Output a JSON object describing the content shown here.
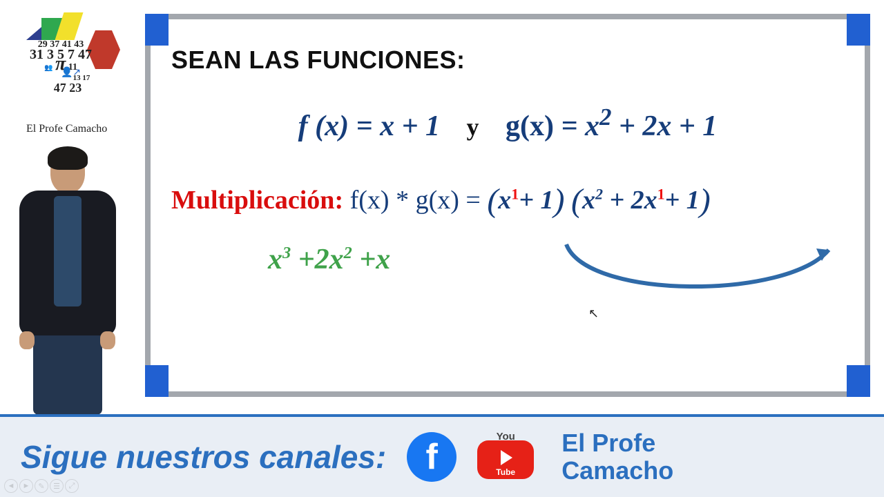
{
  "logo": {
    "numbers_row1": "29 37 41 43",
    "numbers_row2": "31 3 5 7 47",
    "numbers_row3": "11",
    "numbers_row4": "13",
    "numbers_row5": "17",
    "numbers_row6": "47 23",
    "pi": "π",
    "script": "El Profe Camacho"
  },
  "board": {
    "heading": "SEAN LAS FUNCIONES:",
    "f_lhs": "f (x)",
    "eq": " = ",
    "f_rhs": "x + 1",
    "y": "y",
    "g_lhs": "g(x)",
    "g_rhs_a": "x",
    "g_rhs_exp": "2",
    "g_rhs_b": " + 2x + 1",
    "mult_label": "Multiplicación:",
    "mult_plain": "  f(x) * g(x) =",
    "p1_a": "x",
    "p1_exp": "1",
    "p1_b": "+ 1",
    "p2_a": "x",
    "p2_exp1": "2",
    "p2_b": " + 2x",
    "p2_exp2": "1",
    "p2_c": "+ 1",
    "result_a": "x",
    "result_e1": "3",
    "result_b": " +2x",
    "result_e2": "2",
    "result_c": " +x"
  },
  "footer": {
    "cta": "Sigue nuestros canales:",
    "fb": "f",
    "yt_you": "You",
    "yt_tube": "Tube",
    "channel_l1": "El Profe",
    "channel_l2": "Camacho"
  }
}
